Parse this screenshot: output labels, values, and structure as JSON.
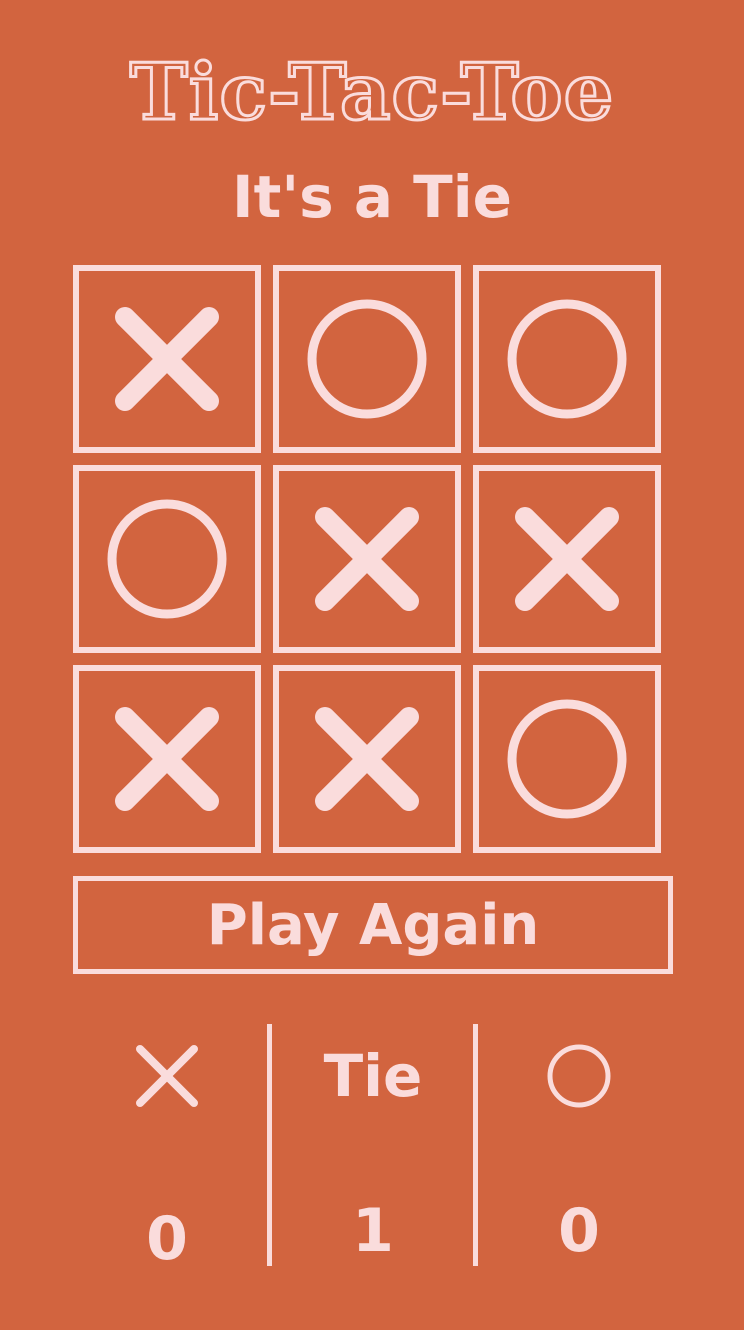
{
  "app": {
    "title": "Tic-Tac-Toe",
    "status": "It's a Tie"
  },
  "board": {
    "cells": [
      "X",
      "O",
      "O",
      "O",
      "X",
      "X",
      "X",
      "X",
      "O"
    ]
  },
  "actions": {
    "play_again_label": "Play Again"
  },
  "scoreboard": {
    "x_icon": "x-mark-icon",
    "tie_label": "Tie",
    "o_icon": "o-mark-icon",
    "x_score": "0",
    "tie_score": "1",
    "o_score": "0"
  },
  "colors": {
    "background": "#d2643f",
    "foreground": "#fadcdc"
  }
}
